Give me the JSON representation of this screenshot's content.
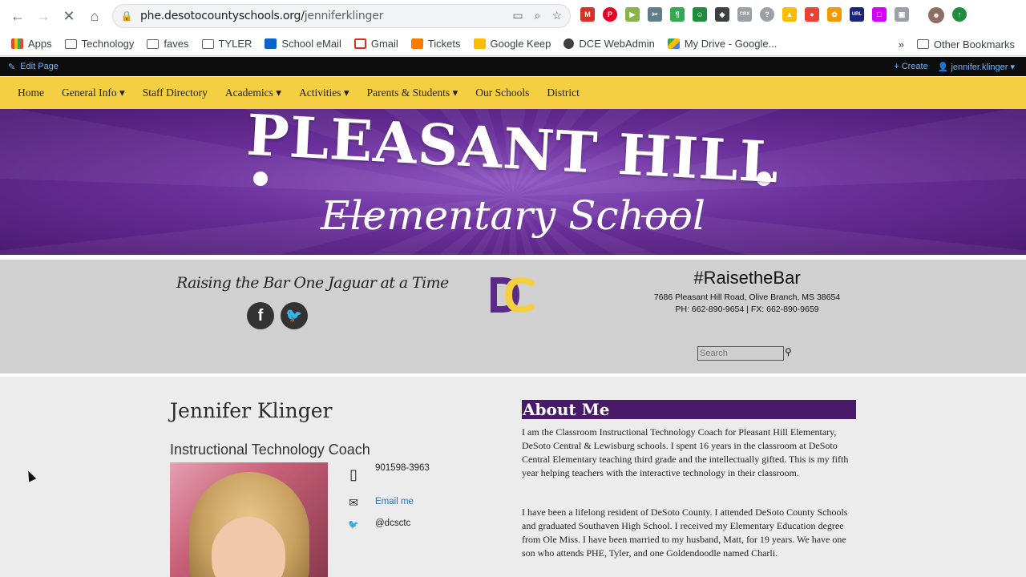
{
  "browser": {
    "url_domain": "phe.desotocountyschools.org/",
    "url_path": "jenniferklinger",
    "bookmarks": [
      {
        "label": "Apps",
        "icon": "apps-grid-icon"
      },
      {
        "label": "Technology",
        "icon": "folder-icon"
      },
      {
        "label": "faves",
        "icon": "folder-icon"
      },
      {
        "label": "TYLER",
        "icon": "folder-icon"
      },
      {
        "label": "School eMail",
        "icon": "outlook-icon"
      },
      {
        "label": "Gmail",
        "icon": "gmail-icon"
      },
      {
        "label": "Tickets",
        "icon": "tickets-icon"
      },
      {
        "label": "Google Keep",
        "icon": "keep-icon"
      },
      {
        "label": "DCE WebAdmin",
        "icon": "globe-icon"
      },
      {
        "label": "My Drive - Google...",
        "icon": "drive-icon"
      }
    ],
    "overflow": "»",
    "other_bookmarks": "Other Bookmarks"
  },
  "admin": {
    "edit_page": "Edit Page",
    "create": "Create",
    "user": "jennifer.klinger"
  },
  "nav": {
    "items": [
      {
        "label": "Home"
      },
      {
        "label": "General Info ▾"
      },
      {
        "label": "Staff Directory"
      },
      {
        "label": "Academics ▾"
      },
      {
        "label": "Activities ▾"
      },
      {
        "label": "Parents & Students ▾"
      },
      {
        "label": "Our Schools"
      },
      {
        "label": "District"
      }
    ]
  },
  "banner": {
    "title": "PLEASANT HILL",
    "subtitle": "Elementary School"
  },
  "header": {
    "tagline": "Raising the Bar One Jaguar at a Time",
    "hashtag": "#RaisetheBar",
    "address": "7686 Pleasant Hill Road, Olive Branch, MS 38654",
    "phone_fax": "PH: 662-890-9654 | FX: 662-890-9659",
    "search_placeholder": "Search",
    "logo_text": "DC",
    "colors": {
      "purple": "#4a1a6a",
      "gold": "#f5cf42"
    }
  },
  "profile": {
    "name": "Jennifer Klinger",
    "role": "Instructional Technology Coach",
    "phone": "901598-3963",
    "email_label": "Email me",
    "twitter": "@dcsctc"
  },
  "about": {
    "heading": "About Me",
    "paragraph1": "I am the Classroom Instructional Technology Coach for Pleasant Hill Elementary, DeSoto Central  & Lewisburg schools.  I spent 16 years in the classroom at DeSoto Central Elementary teaching third grade and the intellectually gifted.  This is my fifth year helping teachers with the interactive technology in their classroom.",
    "paragraph2": "I have been a lifelong resident of DeSoto County.  I attended DeSoto County Schools and graduated Southaven High School. I received my Elementary Education degree from Ole Miss.  I have been married to my husband, Matt, for 19 years.  We have one son who attends  PHE, Tyler, and one Goldendoodle named Charli."
  }
}
